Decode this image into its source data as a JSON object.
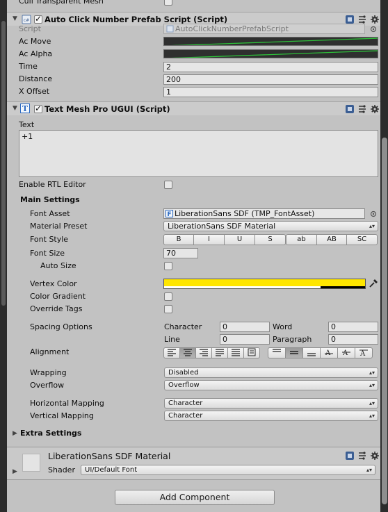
{
  "top": {
    "cull_label": "Cull Transparent Mesh"
  },
  "auto_click": {
    "title": "Auto Click Number Prefab Script (Script)",
    "script_label": "Script",
    "script_value": "AutoClickNumberPrefabScript",
    "ac_move_label": "Ac Move",
    "ac_alpha_label": "Ac Alpha",
    "time_label": "Time",
    "time_value": "2",
    "distance_label": "Distance",
    "distance_value": "200",
    "xoffset_label": "X Offset",
    "xoffset_value": "1"
  },
  "tmp": {
    "title": "Text Mesh Pro UGUI (Script)",
    "text_label": "Text",
    "text_value": "+1",
    "rtl_label": "Enable RTL Editor",
    "main_settings": "Main Settings",
    "font_asset_label": "Font Asset",
    "font_asset_value": "LiberationSans SDF (TMP_FontAsset)",
    "material_preset_label": "Material Preset",
    "material_preset_value": "LiberationSans SDF Material",
    "font_style_label": "Font Style",
    "style_buttons_a": [
      "B",
      "I",
      "U",
      "S"
    ],
    "style_buttons_b": [
      "ab",
      "AB",
      "SC"
    ],
    "font_size_label": "Font Size",
    "font_size_value": "70",
    "auto_size_label": "Auto Size",
    "vertex_color_label": "Vertex Color",
    "vertex_color": "#ffe600",
    "color_gradient_label": "Color Gradient",
    "override_tags_label": "Override Tags",
    "spacing_label": "Spacing Options",
    "character_label": "Character",
    "character_value": "0",
    "word_label": "Word",
    "word_value": "0",
    "line_label": "Line",
    "line_value": "0",
    "paragraph_label": "Paragraph",
    "paragraph_value": "0",
    "alignment_label": "Alignment",
    "wrapping_label": "Wrapping",
    "wrapping_value": "Disabled",
    "overflow_label": "Overflow",
    "overflow_value": "Overflow",
    "hmap_label": "Horizontal Mapping",
    "hmap_value": "Character",
    "vmap_label": "Vertical Mapping",
    "vmap_value": "Character",
    "extra_settings": "Extra Settings"
  },
  "material": {
    "name": "LiberationSans SDF Material",
    "shader_label": "Shader",
    "shader_value": "UI/Default Font"
  },
  "add_component": "Add Component"
}
